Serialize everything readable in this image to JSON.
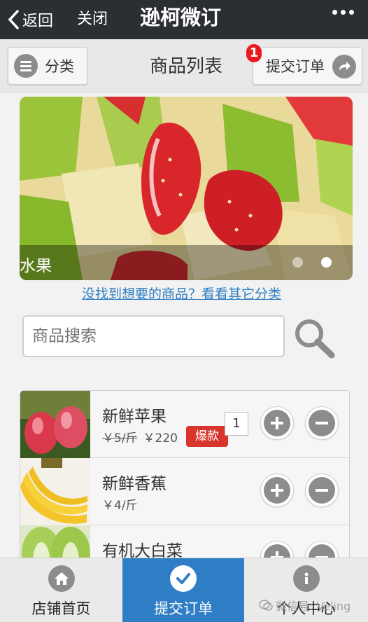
{
  "topbar": {
    "back_label": "返回",
    "close_label": "关闭",
    "title": "逊柯微订"
  },
  "header": {
    "category_label": "分类",
    "page_title": "商品列表",
    "submit_label": "提交订单",
    "cart_badge": "1"
  },
  "banner": {
    "caption": "水果",
    "slide_count": 2,
    "active_slide": 2
  },
  "other_category_link": "没找到想要的商品？看看其它分类",
  "search": {
    "placeholder": "商品搜索"
  },
  "products": [
    {
      "name": "新鲜苹果",
      "original_price": "￥5/斤",
      "price": "￥220",
      "tag": "爆款",
      "quantity": "1"
    },
    {
      "name": "新鲜香蕉",
      "price": "￥4/斤"
    },
    {
      "name": "有机大白菜"
    }
  ],
  "bottom_nav": [
    {
      "label": "店铺首页",
      "icon": "home-icon"
    },
    {
      "label": "提交订单",
      "icon": "check-icon",
      "active": true
    },
    {
      "label": "个人中心",
      "icon": "info-icon"
    }
  ],
  "watermark": "微信号: Veling",
  "colors": {
    "topbar": "#2b2e33",
    "accent": "#2f7ec5",
    "badge": "#e8191e",
    "hot_tag": "#d9342b",
    "link": "#2d7ec4"
  }
}
